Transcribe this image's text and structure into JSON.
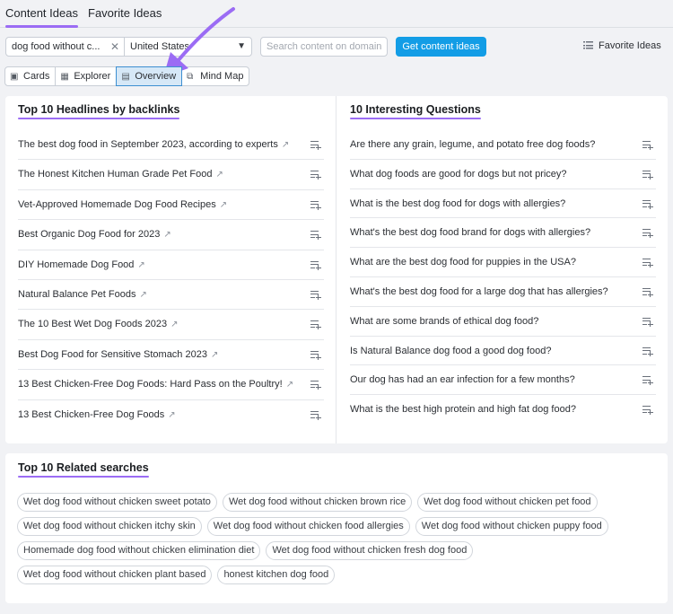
{
  "tabs": [
    {
      "label": "Content Ideas",
      "active": true
    },
    {
      "label": "Favorite Ideas",
      "active": false
    }
  ],
  "controls": {
    "keyword_value": "dog food without c...",
    "country_value": "United States",
    "search_placeholder": "Search content on domain",
    "get_ideas_label": "Get content ideas",
    "favorite_ideas_label": "Favorite Ideas"
  },
  "views": [
    {
      "label": "Cards",
      "icon": "cards-icon",
      "active": false
    },
    {
      "label": "Explorer",
      "icon": "table-icon",
      "active": false
    },
    {
      "label": "Overview",
      "icon": "overview-icon",
      "active": true
    },
    {
      "label": "Mind Map",
      "icon": "mind-map-icon",
      "active": false
    }
  ],
  "headlines": {
    "title": "Top 10 Headlines by backlinks",
    "items": [
      "The best dog food in September 2023, according to experts",
      "The Honest Kitchen Human Grade Pet Food",
      "Vet-Approved Homemade Dog Food Recipes",
      "Best Organic Dog Food for 2023",
      "DIY Homemade Dog Food",
      "Natural Balance Pet Foods",
      "The 10 Best Wet Dog Foods 2023",
      "Best Dog Food for Sensitive Stomach 2023",
      "13 Best Chicken-Free Dog Foods: Hard Pass on the Poultry!",
      "13 Best Chicken-Free Dog Foods"
    ]
  },
  "questions": {
    "title": "10 Interesting Questions",
    "items": [
      "Are there any grain, legume, and potato free dog foods?",
      "What dog foods are good for dogs but not pricey?",
      "What is the best dog food for dogs with allergies?",
      "What's the best dog food brand for dogs with allergies?",
      "What are the best dog food for puppies in the USA?",
      "What's the best dog food for a large dog that has allergies?",
      "What are some brands of ethical dog food?",
      "Is Natural Balance dog food a good dog food?",
      "Our dog has had an ear infection for a few months?",
      "What is the best high protein and high fat dog food?"
    ]
  },
  "related": {
    "title": "Top 10 Related searches",
    "rows": [
      [
        "Wet dog food without chicken sweet potato",
        "Wet dog food without chicken brown rice",
        "Wet dog food without chicken pet food"
      ],
      [
        "Wet dog food without chicken itchy skin",
        "Wet dog food without chicken food allergies",
        "Wet dog food without chicken puppy food"
      ],
      [
        "Homemade dog food without chicken elimination diet",
        "Wet dog food without chicken fresh dog food"
      ],
      [
        "Wet dog food without chicken plant based",
        "honest kitchen dog food"
      ]
    ]
  },
  "colors": {
    "accent_underline": "#9b6cf4",
    "primary_button": "#139de6",
    "active_view_bg": "#d6e8f7",
    "annotation_arrow": "#9b6cf4"
  }
}
